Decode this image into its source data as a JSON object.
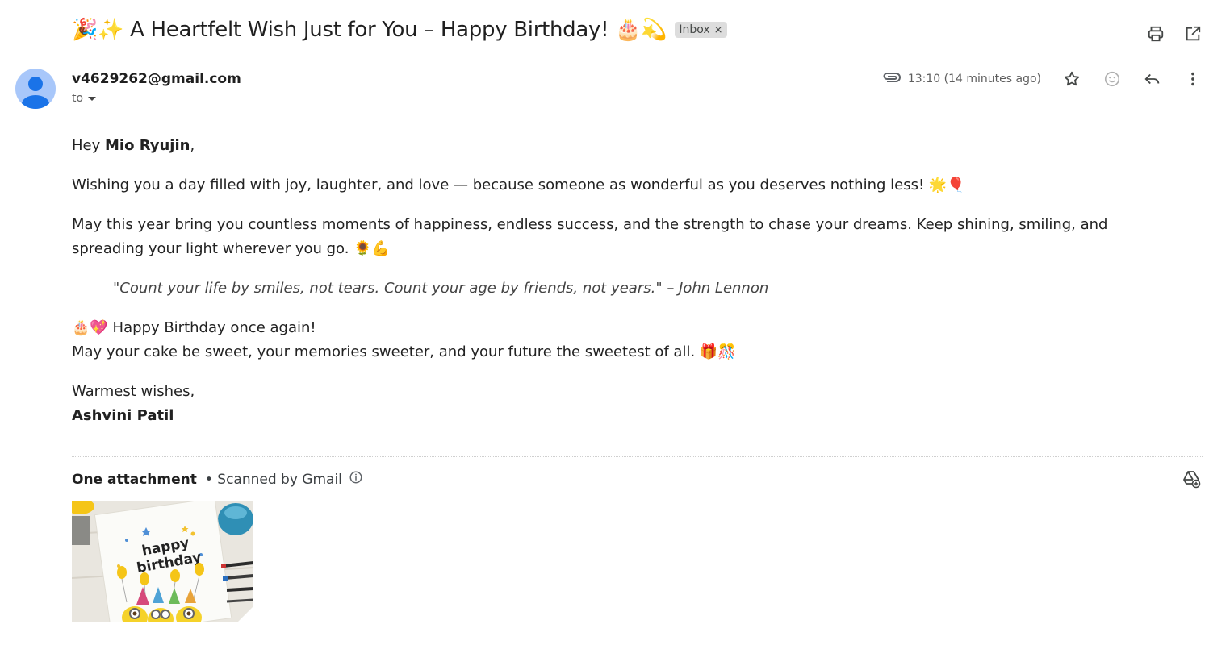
{
  "email": {
    "subject": "🎉✨ A Heartfelt Wish Just for You – Happy Birthday! 🎂💫",
    "label": "Inbox",
    "label_remove": "×",
    "sender": "v4629262@gmail.com",
    "to_label": "to",
    "time": "13:10 (14 minutes ago)"
  },
  "body": {
    "greeting_prefix": "Hey ",
    "greeting_name": "Mio Ryujin",
    "greeting_suffix": ",",
    "para1": "Wishing you a day filled with joy, laughter, and love — because someone as wonderful as you deserves nothing less! 🌟🎈",
    "para2": "May this year bring you countless moments of happiness, endless success, and the strength to chase your dreams. Keep shining, smiling, and spreading your light wherever you go. 🌻💪",
    "quote": "\"Count your life by smiles, not tears. Count your age by friends, not years.\" – John Lennon",
    "line1": "🎂💖 Happy Birthday once again!",
    "line2": "May your cake be sweet, your memories sweeter, and your future the sweetest of all. 🎁🎊",
    "closing": "Warmest wishes,",
    "signature": "Ashvini Patil"
  },
  "attachments": {
    "title": "One attachment",
    "scanned": "• Scanned by Gmail",
    "card_text_1": "happy",
    "card_text_2": "birthday"
  },
  "icons": {
    "print": "print-icon",
    "open_new": "open-in-new-icon",
    "attachment": "paperclip-icon",
    "star": "star-icon",
    "emoji": "emoji-icon",
    "reply": "reply-icon",
    "more": "more-vert-icon",
    "info": "info-icon",
    "drive": "add-to-drive-icon"
  },
  "colors": {
    "avatar_bg": "#a8c7fa",
    "avatar_fg": "#1a73e8",
    "chip_bg": "#dddddd"
  }
}
